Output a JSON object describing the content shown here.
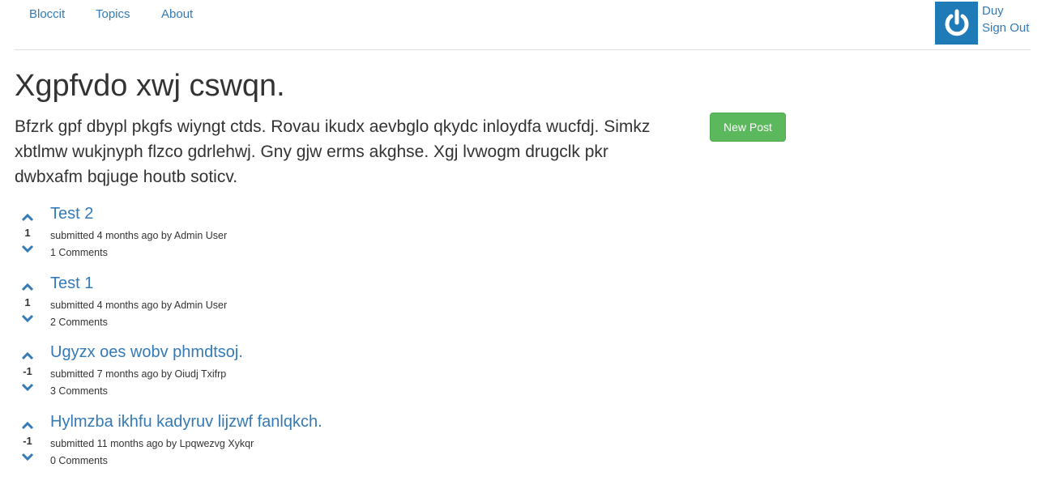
{
  "nav": {
    "brand": "Bloccit",
    "links": [
      "Topics",
      "About"
    ]
  },
  "user": {
    "name": "Duy",
    "sign_out": "Sign Out",
    "avatar_icon": "power-icon",
    "avatar_color": "#1f7ab8"
  },
  "topic": {
    "title": "Xgpfvdo xwj cswqn.",
    "description": "Bfzrk gpf dbypl pkgfs wiyngt ctds. Rovau ikudx aevbglo qkydc inloydfa wucfdj. Simkz xbtlmw wukjnyph flzco gdrlehwj. Gny gjw erms akghse. Xgj lvwogm drugclk pkr dwbxafm bqjuge houtb soticv.",
    "new_post_label": "New Post"
  },
  "posts": [
    {
      "title": "Test 2",
      "votes": "1",
      "meta": "submitted 4 months ago by Admin User",
      "comments": "1 Comments"
    },
    {
      "title": "Test 1",
      "votes": "1",
      "meta": "submitted 4 months ago by Admin User",
      "comments": "2 Comments"
    },
    {
      "title": "Ugyzx oes wobv phmdtsoj.",
      "votes": "-1",
      "meta": "submitted 7 months ago by Oiudj Txifrp",
      "comments": "3 Comments"
    },
    {
      "title": "Hylmzba ikhfu kadyruv lijzwf fanlqkch.",
      "votes": "-1",
      "meta": "submitted 11 months ago by Lpqwezvg Xykqr",
      "comments": "0 Comments"
    }
  ],
  "colors": {
    "link": "#337ab7",
    "success": "#5cb85c",
    "text": "#333333"
  }
}
